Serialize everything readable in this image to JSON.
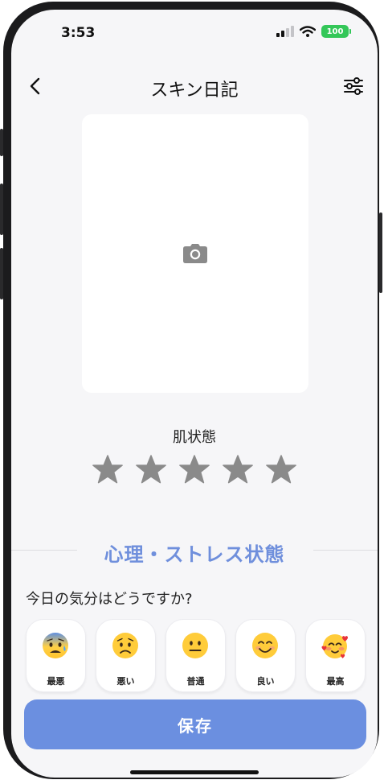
{
  "status_bar": {
    "time": "3:53",
    "battery": "100",
    "colors": {
      "battery": "#34c759"
    }
  },
  "nav": {
    "title": "スキン日記",
    "back_icon": "chevron-left-icon",
    "filter_icon": "sliders-icon"
  },
  "photo": {
    "icon": "camera-icon"
  },
  "skin": {
    "label": "肌状態",
    "rating": 0,
    "max_rating": 5
  },
  "mental": {
    "title": "心理・ストレス状態",
    "question": "今日の気分はどうですか?",
    "options": [
      {
        "label": "最悪",
        "icon": "anxious-face-icon"
      },
      {
        "label": "悪い",
        "icon": "worried-face-icon"
      },
      {
        "label": "普通",
        "icon": "neutral-face-icon"
      },
      {
        "label": "良い",
        "icon": "smiling-face-icon"
      },
      {
        "label": "最高",
        "icon": "face-with-hearts-icon"
      }
    ]
  },
  "save_button": {
    "label": "保存"
  },
  "colors": {
    "accent": "#6f8fdc",
    "button": "#6b8fe0",
    "star": "#8a8a8a",
    "background": "#f6f6f8"
  }
}
